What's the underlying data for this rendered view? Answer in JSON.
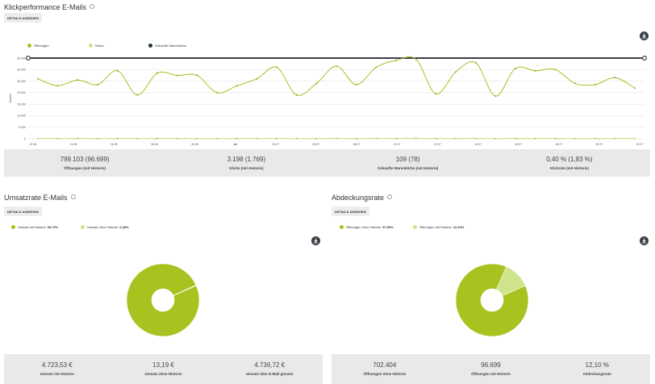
{
  "klick": {
    "title": "Klickperformance E-Mails",
    "details_label": "DETAILS ANSEHEN",
    "legend": [
      {
        "label": "Öffnungen",
        "color": "#a9c21f"
      },
      {
        "label": "Klicks",
        "color": "#cfe38a"
      },
      {
        "label": "Gekaufte Warenkörbe",
        "color": "#1d3b1f"
      }
    ],
    "stats": [
      {
        "value": "799.103 (96.699)",
        "label": "Öffnungen (mit Historie)"
      },
      {
        "value": "3.198 (1.769)",
        "label": "Klicks (mit Historie)"
      },
      {
        "value": "109 (78)",
        "label": "Gekaufte Warenkörbe (mit Historie)"
      },
      {
        "value": "0,40 % (1,83 %)",
        "label": "Klickrate (mit Historie)"
      }
    ]
  },
  "umsatz": {
    "title": "Umsatzrate E-Mails",
    "details_label": "DETAILS ANSEHEN",
    "legend": [
      {
        "label": "Umsatz mit Historie",
        "pct": "99,72%",
        "color": "#a9c21f"
      },
      {
        "label": "Umsatz ohne Historie",
        "pct": "0,28%",
        "color": "#cfe38a"
      }
    ],
    "stats": [
      {
        "value": "4.723,53 €",
        "label": "Umsatz mit Historie"
      },
      {
        "value": "13,19 €",
        "label": "Umsatz ohne Historie"
      },
      {
        "value": "4.736,72 €",
        "label": "Umsatz über E-Mail gesamt"
      }
    ]
  },
  "abdeckung": {
    "title": "Abdeckungsrate",
    "details_label": "DETAILS ANSEHEN",
    "legend": [
      {
        "label": "Öffnungen ohne Historie",
        "pct": "87,90%",
        "color": "#a9c21f"
      },
      {
        "label": "Öffnungen mit Historie",
        "pct": "12,10%",
        "color": "#cfe38a"
      }
    ],
    "stats": [
      {
        "value": "702.404",
        "label": "Öffnungen ohne Historie"
      },
      {
        "value": "96.699",
        "label": "Öffnungen mit Historie"
      },
      {
        "value": "12,10 %",
        "label": "Abdeckungsrate"
      }
    ]
  },
  "chart_data": [
    {
      "type": "line",
      "ylabel": "Anzahl",
      "ylim": [
        0,
        35000
      ],
      "yticks": [
        "0",
        "5.000",
        "10.000",
        "15.000",
        "20.000",
        "25.000",
        "30.000",
        "35.000"
      ],
      "xticks": [
        "22.06",
        "24.06",
        "26.06",
        "28.06",
        "30.06",
        "Jul",
        "04.07",
        "06.07",
        "08.07",
        "10.07",
        "12.07",
        "14.07",
        "16.07",
        "18.07",
        "20.07",
        "22.07"
      ],
      "grid": true,
      "series": [
        {
          "name": "Öffnungen",
          "color": "#a9c21f",
          "values": [
            26000,
            23000,
            25500,
            23500,
            29500,
            19000,
            28500,
            27500,
            27500,
            20000,
            23000,
            26000,
            31000,
            19000,
            24000,
            31500,
            23500,
            31000,
            34000,
            34500,
            19500,
            29000,
            33000,
            18500,
            30500,
            29500,
            30000,
            24000,
            23500,
            26500,
            22000
          ]
        },
        {
          "name": "Klicks",
          "color": "#cfe38a",
          "values": [
            150,
            100,
            120,
            90,
            140,
            80,
            130,
            120,
            110,
            80,
            100,
            110,
            150,
            70,
            100,
            160,
            90,
            140,
            170,
            180,
            80,
            130,
            160,
            70,
            140,
            130,
            130,
            100,
            90,
            110,
            80
          ]
        },
        {
          "name": "Gekaufte Warenkörbe",
          "color": "#1d3b1f",
          "values": [
            35000,
            35000,
            35000,
            35000,
            35000,
            35000,
            35000,
            35000,
            35000,
            35000,
            35000,
            35000,
            35000,
            35000,
            35000,
            35000,
            35000,
            35000,
            35000,
            35000,
            35000,
            35000,
            35000,
            35000,
            35000,
            35000,
            35000,
            35000,
            35000,
            35000,
            35000
          ]
        }
      ]
    },
    {
      "type": "pie",
      "categories": [
        "Umsatz mit Historie",
        "Umsatz ohne Historie"
      ],
      "values": [
        99.72,
        0.28
      ],
      "colors": [
        "#a9c21f",
        "#cfe38a"
      ]
    },
    {
      "type": "pie",
      "categories": [
        "Öffnungen ohne Historie",
        "Öffnungen mit Historie"
      ],
      "values": [
        87.9,
        12.1
      ],
      "colors": [
        "#a9c21f",
        "#cfe38a"
      ]
    }
  ]
}
